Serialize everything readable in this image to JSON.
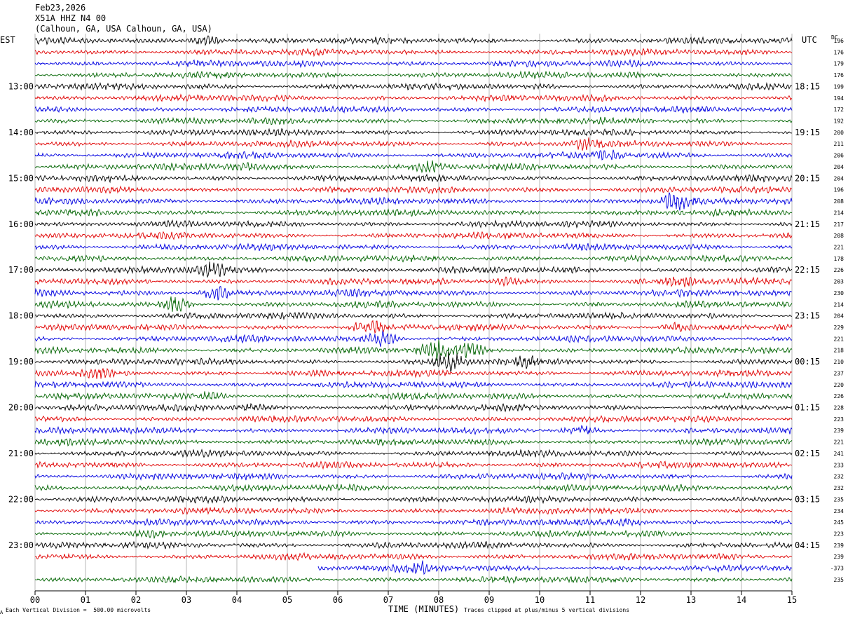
{
  "header": {
    "date": "Feb23,2026",
    "station": "X51A HHZ N4 00",
    "location": "(Calhoun, GA, USA Calhoun, GA, USA)"
  },
  "timezones": {
    "left": "EST",
    "right": "UTC"
  },
  "dc_header": "DC",
  "footer": {
    "left": "Each Vertical Division =  500.00 microvolts",
    "right": "Traces clipped at plus/minus 5 vertical divisions",
    "corner": "A"
  },
  "colors": {
    "trace_cycle": [
      "#000000",
      "#e00000",
      "#0000e0",
      "#006400"
    ],
    "grid": "#888888"
  },
  "chart_data": {
    "type": "line",
    "subtype": "helicorder",
    "title": "",
    "xlabel": "TIME (MINUTES)",
    "xlim": [
      0,
      15
    ],
    "x_ticks": [
      "00",
      "01",
      "02",
      "03",
      "04",
      "05",
      "06",
      "07",
      "08",
      "09",
      "10",
      "11",
      "12",
      "13",
      "14",
      "15"
    ],
    "trace_count": 48,
    "minutes_per_trace": 15,
    "left_time_labels": [
      "13:00",
      "14:00",
      "15:00",
      "16:00",
      "17:00",
      "18:00",
      "19:00",
      "20:00",
      "21:00",
      "22:00",
      "23:00"
    ],
    "right_time_labels": [
      "18:15",
      "19:15",
      "20:15",
      "21:15",
      "22:15",
      "23:15",
      "00:15",
      "01:15",
      "02:15",
      "03:15",
      "04:15"
    ],
    "dc_offsets": [
      "196",
      "176",
      "179",
      "176",
      "199",
      "194",
      "172",
      "192",
      "200",
      "211",
      "206",
      "204",
      "204",
      "196",
      "208",
      "214",
      "217",
      "208",
      "221",
      "178",
      "226",
      "203",
      "230",
      "214",
      "204",
      "229",
      "221",
      "218",
      "210",
      "237",
      "220",
      "226",
      "228",
      "223",
      "239",
      "221",
      "241",
      "233",
      "232",
      "232",
      "235",
      "234",
      "245",
      "223",
      "239",
      "239",
      "-373",
      "235"
    ],
    "bursts": [
      {
        "trace": 0,
        "minute": 3.4,
        "strength": 2.0
      },
      {
        "trace": 9,
        "minute": 10.9,
        "strength": 1.6
      },
      {
        "trace": 10,
        "minute": 11.4,
        "strength": 1.7
      },
      {
        "trace": 11,
        "minute": 4.2,
        "strength": 1.3
      },
      {
        "trace": 11,
        "minute": 7.8,
        "strength": 2.0
      },
      {
        "trace": 14,
        "minute": 12.7,
        "strength": 2.8
      },
      {
        "trace": 20,
        "minute": 3.5,
        "strength": 2.5
      },
      {
        "trace": 21,
        "minute": 9.4,
        "strength": 1.3
      },
      {
        "trace": 21,
        "minute": 12.8,
        "strength": 1.6
      },
      {
        "trace": 22,
        "minute": 3.6,
        "strength": 2.8
      },
      {
        "trace": 23,
        "minute": 2.8,
        "strength": 3.0
      },
      {
        "trace": 25,
        "minute": 6.6,
        "strength": 2.6
      },
      {
        "trace": 25,
        "minute": 12.7,
        "strength": 1.4
      },
      {
        "trace": 26,
        "minute": 6.9,
        "strength": 3.0
      },
      {
        "trace": 27,
        "minute": 7.9,
        "strength": 3.5
      },
      {
        "trace": 27,
        "minute": 8.6,
        "strength": 2.4
      },
      {
        "trace": 28,
        "minute": 8.2,
        "strength": 3.0
      },
      {
        "trace": 28,
        "minute": 9.7,
        "strength": 1.5
      },
      {
        "trace": 29,
        "minute": 1.2,
        "strength": 1.3
      },
      {
        "trace": 31,
        "minute": 3.5,
        "strength": 1.2
      },
      {
        "trace": 32,
        "minute": 4.3,
        "strength": 1.3
      },
      {
        "trace": 34,
        "minute": 10.8,
        "strength": 1.5
      },
      {
        "trace": 42,
        "minute": 11.8,
        "strength": 1.2
      },
      {
        "trace": 43,
        "minute": 2.3,
        "strength": 1.3
      },
      {
        "trace": 46,
        "minute": 7.6,
        "strength": 1.8
      }
    ],
    "gaps": [
      {
        "trace": 46,
        "start_minute": 0,
        "end_minute": 5.6
      }
    ]
  }
}
